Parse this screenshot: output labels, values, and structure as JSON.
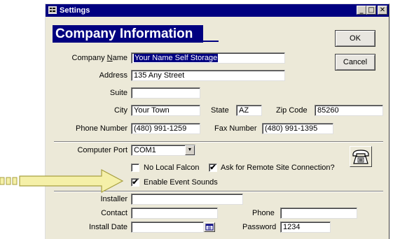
{
  "window": {
    "title": "Settings",
    "minimize": "_",
    "maximize": "□",
    "close": "✕"
  },
  "header": {
    "title": "Company Information"
  },
  "buttons": {
    "ok": "OK",
    "cancel": "Cancel"
  },
  "company": {
    "name_label_pre": "Company ",
    "name_label_u": "N",
    "name_label_post": "ame",
    "name_value": "Your Name Self Storage",
    "address_label": "Address",
    "address_value": "135 Any Street",
    "suite_label": "Suite",
    "suite_value": "",
    "city_label": "City",
    "city_value": "Your Town",
    "state_label": "State",
    "state_value": "AZ",
    "zip_label": "Zip Code",
    "zip_value": "85260",
    "phone_label": "Phone Number",
    "phone_value": "(480) 991-1259",
    "fax_label": "Fax Number",
    "fax_value": "(480) 991-1395"
  },
  "port": {
    "label": "Computer Port",
    "value": "COM1",
    "no_local_falcon_label": "No Local Falcon",
    "no_local_falcon_checked": false,
    "remote_site_label": "Ask for Remote Site Connection?",
    "remote_site_checked": true,
    "event_sounds_label": "Enable Event Sounds",
    "event_sounds_checked": true,
    "check_mark": "✔"
  },
  "installer": {
    "installer_label": "Installer",
    "installer_value": "",
    "contact_label": "Contact",
    "contact_value": "",
    "phone_label": "Phone",
    "phone_value": "",
    "install_date_label": "Install Date",
    "install_date_value": "",
    "password_label": "Password",
    "password_value": "1234"
  },
  "icons": {
    "app": "settings-window-icon",
    "phone": "telephone-icon",
    "calendar": "calendar-icon",
    "arrow": "pointer-arrow-icon"
  },
  "colors": {
    "titlebar": "#000080",
    "dialog": "#ece9d8",
    "arrow_fill": "#f5f0a8",
    "arrow_stroke": "#a8a040"
  }
}
